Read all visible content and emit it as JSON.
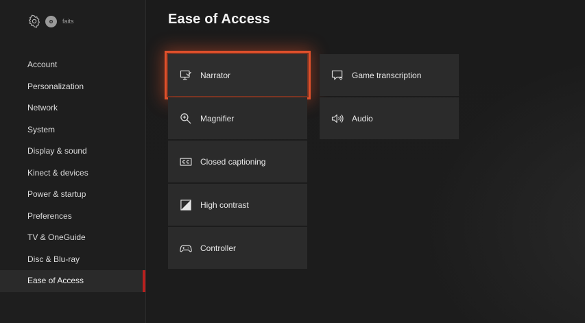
{
  "header": {
    "avatar_initial": "o",
    "gamertag": "faits"
  },
  "sidebar": {
    "items": [
      {
        "label": "Account"
      },
      {
        "label": "Personalization"
      },
      {
        "label": "Network"
      },
      {
        "label": "System"
      },
      {
        "label": "Display & sound"
      },
      {
        "label": "Kinect & devices"
      },
      {
        "label": "Power & startup"
      },
      {
        "label": "Preferences"
      },
      {
        "label": "TV & OneGuide"
      },
      {
        "label": "Disc & Blu-ray"
      },
      {
        "label": "Ease of Access",
        "selected": true
      }
    ]
  },
  "main": {
    "title": "Ease of Access",
    "tiles": [
      {
        "label": "Narrator",
        "icon": "narrator-icon",
        "focused": true
      },
      {
        "label": "Magnifier",
        "icon": "magnifier-icon"
      },
      {
        "label": "Closed captioning",
        "icon": "closed-captioning-icon"
      },
      {
        "label": "High contrast",
        "icon": "high-contrast-icon"
      },
      {
        "label": "Controller",
        "icon": "controller-icon"
      },
      {
        "label": "Game transcription",
        "icon": "game-transcription-icon"
      },
      {
        "label": "Audio",
        "icon": "speaker-icon"
      }
    ]
  },
  "colors": {
    "focus_outline": "#e0502b",
    "selected_indicator": "#b8201e"
  }
}
